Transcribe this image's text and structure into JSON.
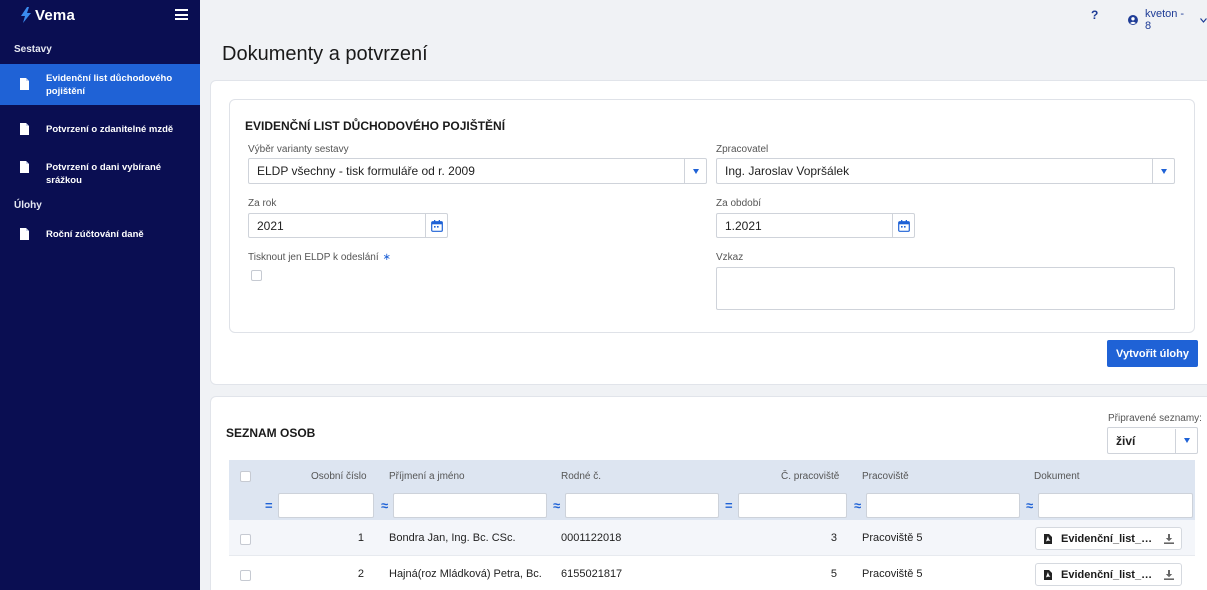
{
  "brand": {
    "name": "Vema"
  },
  "sidebar": {
    "sections": [
      {
        "title": "Sestavy"
      },
      {
        "title": "Úlohy"
      }
    ],
    "items": [
      {
        "label": "Evidenční list důchodového pojištění"
      },
      {
        "label": "Potvrzení o zdanitelné mzdě"
      },
      {
        "label": "Potvrzení o dani vybírané srážkou"
      },
      {
        "label": "Roční zúčtování daně"
      }
    ]
  },
  "topbar": {
    "help": "?",
    "user": "kveton - 8"
  },
  "page": {
    "title": "Dokumenty a potvrzení"
  },
  "form": {
    "title": "EVIDENČNÍ LIST DŮCHODOVÉHO POJIŠTĚNÍ",
    "variant_label": "Výběr varianty sestavy",
    "variant_value": "ELDP všechny - tisk formuláře od r. 2009",
    "processor_label": "Zpracovatel",
    "processor_value": "Ing. Jaroslav Vopršálek",
    "year_label": "Za rok",
    "year_value": "2021",
    "period_label": "Za období",
    "period_value": "1.2021",
    "print_only_label": "Tisknout jen ELDP k odeslání",
    "print_only_req": "∗",
    "message_label": "Vzkaz",
    "message_value": "",
    "create_button": "Vytvořit úlohy"
  },
  "list": {
    "title": "SEZNAM OSOB",
    "prepared_label": "Připravené seznamy:",
    "prepared_value": "živí",
    "columns": [
      "Osobní číslo",
      "Příjmení a jméno",
      "Rodné č.",
      "Č. pracoviště",
      "Pracoviště",
      "Dokument"
    ],
    "filter_ops": [
      "=",
      "≈",
      "≈",
      "=",
      "≈",
      "≈"
    ],
    "rows": [
      {
        "id": "1",
        "name": "Bondra Jan, Ing. Bc. CSc.",
        "birth": "0001122018",
        "workplace_no": "3",
        "workplace": "Pracoviště 5",
        "document": "Evidenční_list_důchodového_pojištění"
      },
      {
        "id": "2",
        "name": "Hajná(roz Mládková) Petra, Bc.",
        "birth": "6155021817",
        "workplace_no": "5",
        "workplace": "Pracoviště 5",
        "document": "Evidenční_list_důchodového_pojištění"
      }
    ]
  },
  "colors": {
    "sidebar": "#0a0e52",
    "accent": "#1f62d6",
    "header_row": "#dde5f1"
  }
}
